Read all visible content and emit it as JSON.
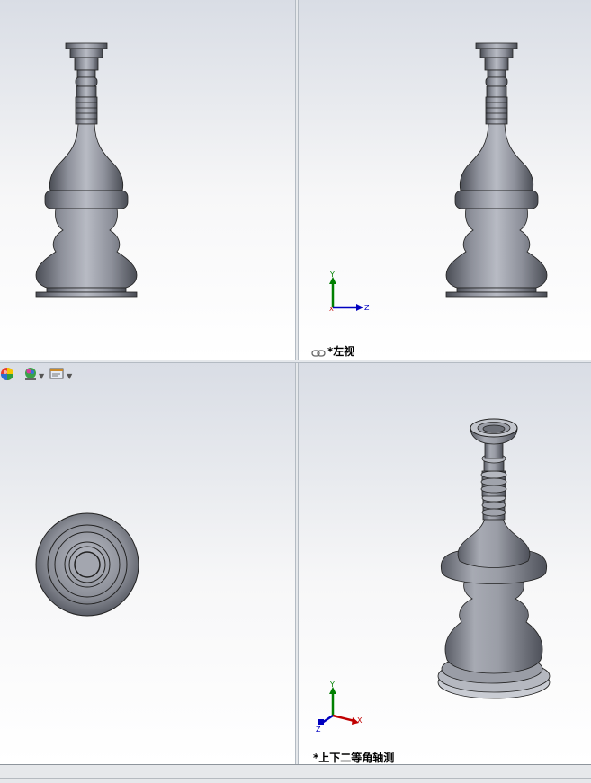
{
  "viewports": {
    "left_view_label": "*左视",
    "iso_view_label": "*上下二等角轴测"
  },
  "triad": {
    "axis_x": "X",
    "axis_y": "Y",
    "axis_z": "Z"
  },
  "toolbar": {
    "icons": [
      "appearance-sphere-icon",
      "scene-icon",
      "view-settings-icon"
    ]
  },
  "colors": {
    "model_fill": "#8a8d96",
    "axis_x": "#c00000",
    "axis_y": "#008000",
    "axis_z": "#0000c0"
  }
}
